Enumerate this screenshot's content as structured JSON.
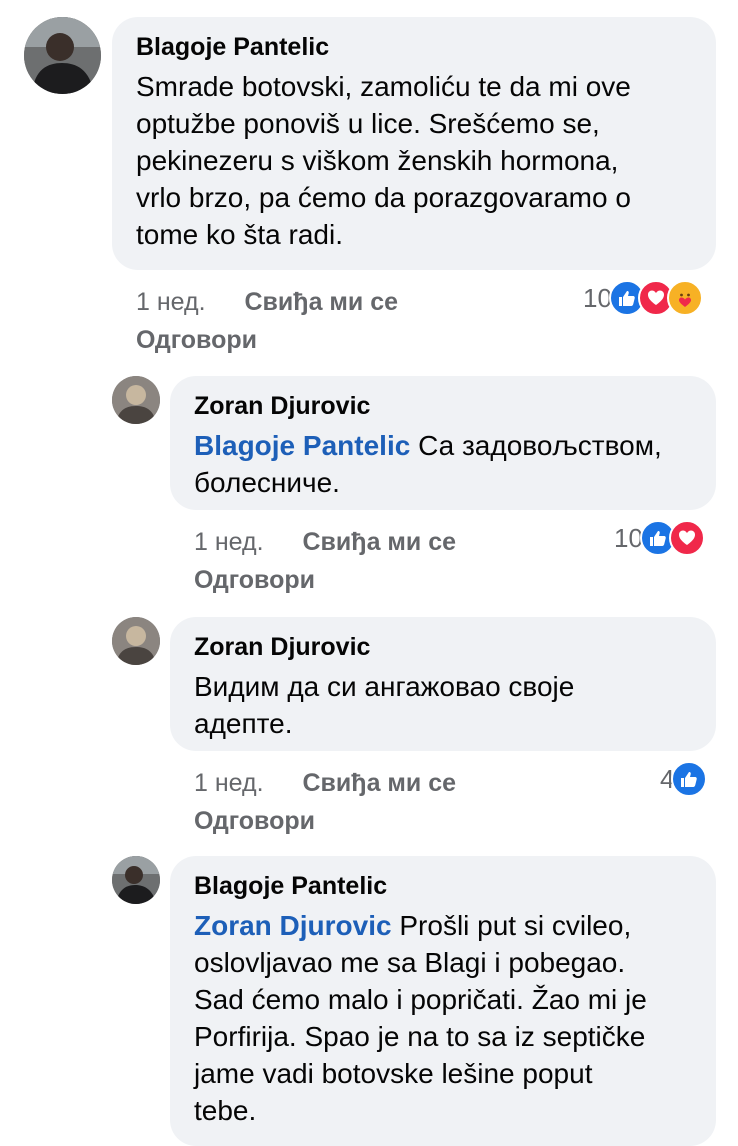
{
  "comments": [
    {
      "author": "Blagoje Pantelic",
      "mention": "",
      "text": "Smrade botovski, zamoliću te da mi ove\noptužbe ponoviš u lice. Srešćemo se,\npekinezeru s viškom ženskih hormona,\nvrlo brzo, pa ćemo da porazgovaramo o\ntome ko šta radi.",
      "time": "1 нед.",
      "like": "Свиђа ми се",
      "reply": "Одговори",
      "reaction_count": "10",
      "reactions": [
        "like-icon",
        "love-icon",
        "care-icon"
      ]
    },
    {
      "author": "Zoran Djurovic",
      "mention": "Blagoje Pantelic",
      "text": " Са задовољством,\nболесниче.",
      "time": "1 нед.",
      "like": "Свиђа ми се",
      "reply": "Одговори",
      "reaction_count": "10",
      "reactions": [
        "like-icon",
        "love-icon"
      ]
    },
    {
      "author": "Zoran Djurovic",
      "mention": "",
      "text": "Видим да си ангажовао своје\nадепте.",
      "time": "1 нед.",
      "like": "Свиђа ми се",
      "reply": "Одговори",
      "reaction_count": "4",
      "reactions": [
        "like-icon"
      ]
    },
    {
      "author": "Blagoje Pantelic",
      "mention": "Zoran Djurovic",
      "text": " Prošli put si cvileo,\noslovljavao me sa Blagi i pobegao.\nSad ćemo malo i popričati. Žao mi je\nPorfirija. Spao je na to sa iz septičke\njame vadi botovske lešine poput\ntebe.",
      "time": "",
      "like": "",
      "reply": "",
      "reaction_count": "",
      "reactions": []
    }
  ],
  "colors": {
    "bubble": "#f0f2f5",
    "mention": "#1d5fb8",
    "meta": "#65676b",
    "like": "#1b74e4",
    "love": "#f0284a",
    "care": "#f7b125"
  }
}
